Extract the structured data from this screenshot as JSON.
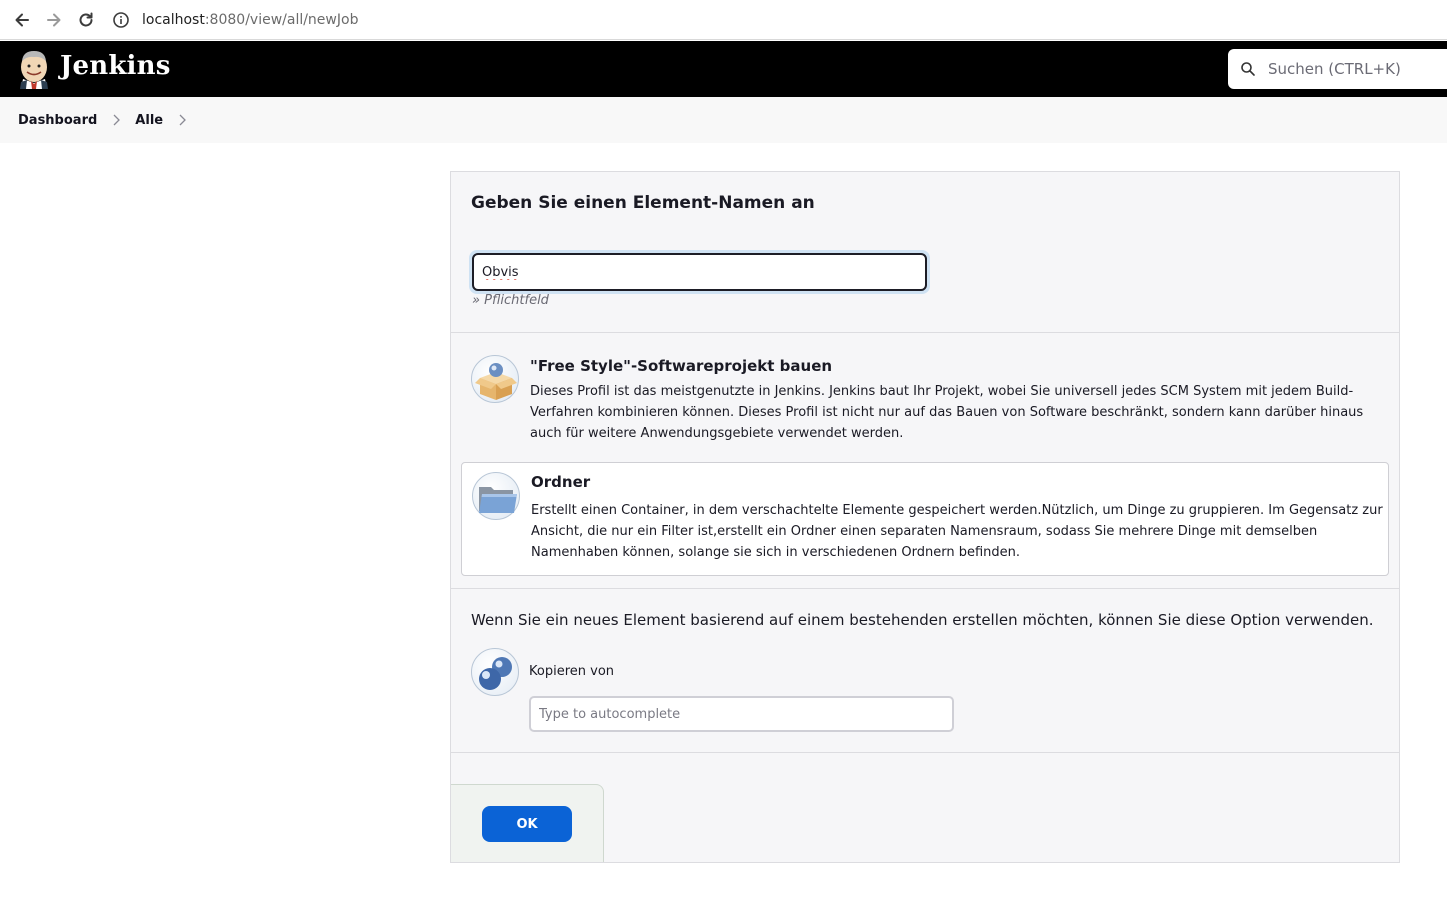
{
  "browser": {
    "url_host": "localhost",
    "url_rest": ":8080/view/all/newJob"
  },
  "header": {
    "title": "Jenkins",
    "search_placeholder": "Suchen (CTRL+K)"
  },
  "breadcrumb": {
    "items": [
      {
        "label": "Dashboard"
      },
      {
        "label": "Alle"
      }
    ]
  },
  "form": {
    "title": "Geben Sie einen Element-Namen an",
    "name_value": "Obvis",
    "required_note": "» Pflichtfeld"
  },
  "item_types": [
    {
      "title": "\"Free Style\"-Softwareprojekt bauen",
      "description": "Dieses Profil ist das meistgenutzte in Jenkins. Jenkins baut Ihr Projekt, wobei Sie universell jedes SCM System mit jedem Build-Verfahren kombinieren können. Dieses Profil ist nicht nur auf das Bauen von Software beschränkt, sondern kann darüber hinaus auch für weitere Anwendungsgebiete verwendet werden.",
      "icon": "freestyle-box-icon",
      "selected": false
    },
    {
      "title": "Ordner",
      "description": "Erstellt einen Container, in dem verschachtelte Elemente gespeichert werden.Nützlich, um Dinge zu gruppieren. Im Gegensatz zur Ansicht, die nur ein Filter ist,erstellt ein Ordner einen separaten Namensraum, sodass Sie mehrere Dinge mit demselben Namenhaben können, solange sie sich in verschiedenen Ordnern befinden.",
      "icon": "folder-icon",
      "selected": true
    }
  ],
  "copy": {
    "text": "Wenn Sie ein neues Element basierend auf einem bestehenden erstellen möchten, können Sie diese Option verwenden.",
    "label": "Kopieren von",
    "placeholder": "Type to autocomplete"
  },
  "actions": {
    "ok_label": "OK"
  },
  "colors": {
    "header_bg": "#000000",
    "primary_button": "#0b63d6",
    "panel_bg": "#f6f6f8"
  }
}
